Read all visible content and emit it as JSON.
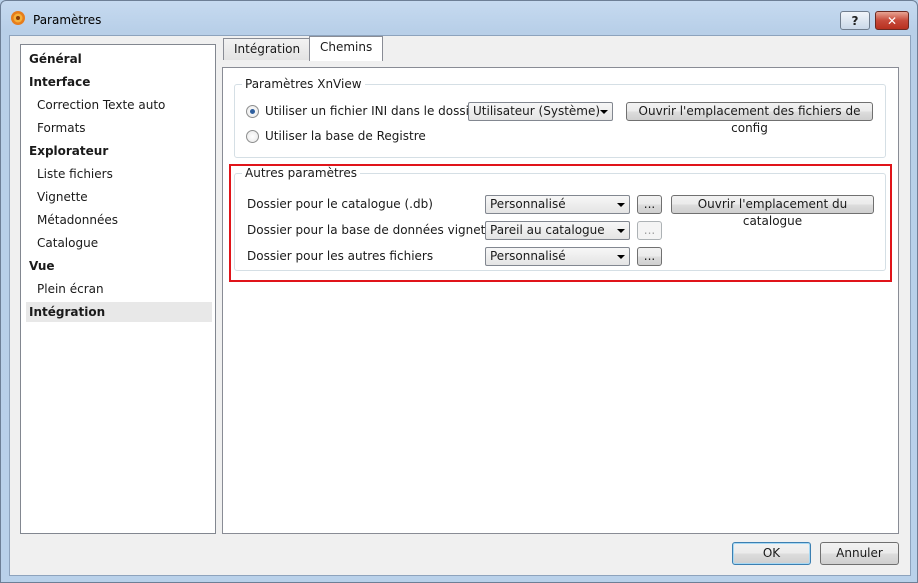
{
  "window": {
    "title": "Paramètres",
    "help_label": "?",
    "close_label": "✕"
  },
  "nav": {
    "items": [
      {
        "label": "Général",
        "kind": "cat"
      },
      {
        "label": "Interface",
        "kind": "cat"
      },
      {
        "label": "Correction Texte auto",
        "kind": "sub"
      },
      {
        "label": "Formats",
        "kind": "sub"
      },
      {
        "label": "Explorateur",
        "kind": "cat"
      },
      {
        "label": "Liste fichiers",
        "kind": "sub"
      },
      {
        "label": "Vignette",
        "kind": "sub"
      },
      {
        "label": "Métadonnées",
        "kind": "sub"
      },
      {
        "label": "Catalogue",
        "kind": "sub"
      },
      {
        "label": "Vue",
        "kind": "cat"
      },
      {
        "label": "Plein écran",
        "kind": "sub"
      },
      {
        "label": "Intégration",
        "kind": "cat",
        "selected": true
      }
    ]
  },
  "tabs": [
    {
      "label": "Intégration"
    },
    {
      "label": "Chemins",
      "active": true
    }
  ],
  "xnview_group": {
    "legend": "Paramètres XnView",
    "radio_ini_label": "Utiliser un fichier INI dans le dossier",
    "radio_registry_label": "Utiliser la base de Registre",
    "folder_select_value": "Utilisateur (Système)",
    "open_config_button": "Ouvrir l'emplacement des fichiers de config"
  },
  "other_group": {
    "legend": "Autres paramètres",
    "rows": [
      {
        "label": "Dossier pour le catalogue (.db)",
        "select": "Personnalisé",
        "browse": "...",
        "browse_enabled": true,
        "extra_button": "Ouvrir l'emplacement du catalogue"
      },
      {
        "label": "Dossier pour la base de données vignettes",
        "select": "Pareil au catalogue",
        "browse": "...",
        "browse_enabled": false
      },
      {
        "label": "Dossier pour les autres fichiers",
        "select": "Personnalisé",
        "browse": "...",
        "browse_enabled": true
      }
    ]
  },
  "footer": {
    "ok_label": "OK",
    "cancel_label": "Annuler"
  },
  "colors": {
    "highlight_border": "#e0141a",
    "window_frame": "#b9d1ea"
  }
}
